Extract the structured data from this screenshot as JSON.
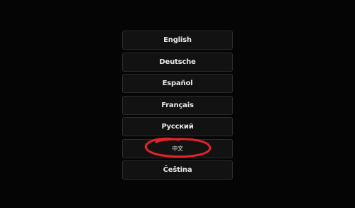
{
  "languages": [
    {
      "label": "English"
    },
    {
      "label": "Deutsche"
    },
    {
      "label": "Español"
    },
    {
      "label": "Français"
    },
    {
      "label": "Русский"
    },
    {
      "label": "中文"
    },
    {
      "label": "Čeština"
    }
  ],
  "colors": {
    "background": "#050505",
    "button_bg": "#121212",
    "button_border": "#2b2b2b",
    "text": "#e8e8e8",
    "annotation": "#e0242c"
  }
}
